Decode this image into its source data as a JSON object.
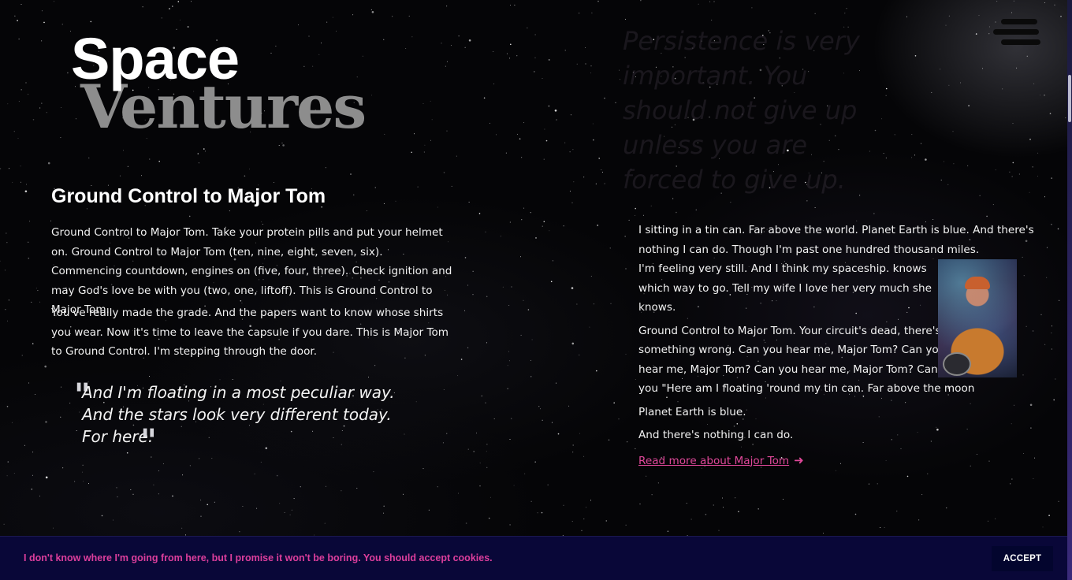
{
  "logo": {
    "line1": "Space",
    "line2": "Ventures"
  },
  "ghost_quote": "Persistence is very important. You should not give up unless you are forced to give up.",
  "menu": {
    "icon": "hamburger-menu-icon"
  },
  "article": {
    "heading": "Ground Control to Major Tom",
    "paragraph1": "Ground Control to Major Tom. Take your protein pills and put your helmet on. Ground Control to Major Tom (ten, nine, eight, seven, six). Commencing countdown, engines on (five, four, three). Check ignition and may God's love be with you (two, one, liftoff). This is Ground Control to Major Tom.",
    "paragraph2": "You've really made the grade. And the papers want to know whose shirts you wear. Now it's time to leave the capsule if you dare. This is Major Tom to Ground Control. I'm stepping through the door.",
    "quote_lines": [
      "And I'm floating in a most peculiar way.",
      "And the stars look very different today.",
      "For here."
    ]
  },
  "side": {
    "paragraph1_lines": [
      "I sitting in a tin can. Far above the world. Planet Earth is blue. And there's",
      "nothing I can do. Though I'm past one hundred thousand miles.",
      "I'm feeling very still. And I think my spaceship. knows",
      "which way to go. Tell my wife I love her very much she",
      "knows."
    ],
    "paragraph2_lines": [
      "Ground Control to Major Tom. Your circuit's dead, there's",
      "something wrong. Can you hear me, Major Tom? Can you",
      "hear me, Major Tom? Can you hear me, Major Tom? Can",
      "you \"Here am I floating 'round my tin can. Far above the moon"
    ],
    "paragraph3": "Planet Earth is blue.",
    "paragraph4": "And there's nothing I can do.",
    "read_more": "Read more about Major Tom",
    "arrow": "➜",
    "image_icon": "astronaut-portrait"
  },
  "cookie": {
    "text": "I don't know where I'm going from here, but I promise it won't be boring. You should accept cookies.",
    "accept_label": "ACCEPT"
  },
  "colors": {
    "accent": "#e0489a",
    "cookie_bg": "#090738",
    "button_bg": "#03052e",
    "logo_gray": "#8d8d8d"
  }
}
